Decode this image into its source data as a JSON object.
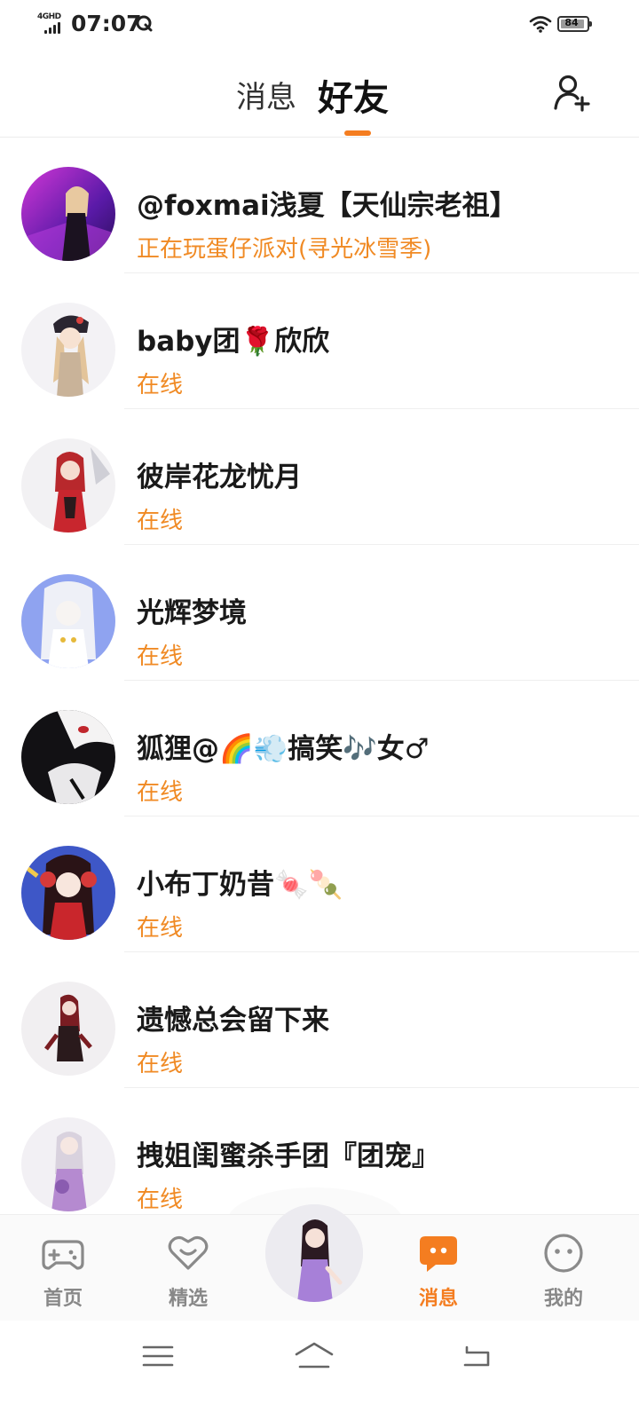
{
  "status_bar": {
    "network": "4GHD",
    "time": "07:07",
    "battery": "84"
  },
  "header": {
    "tab_messages": "消息",
    "tab_friends": "好友",
    "active_tab": "好友",
    "add_friend_icon": "add-user-icon"
  },
  "friends": [
    {
      "name": "@foxmai浅夏【天仙宗老祖】",
      "status": "正在玩蛋仔派对(寻光冰雪季)"
    },
    {
      "name": "baby团🌹欣欣",
      "status": "在线"
    },
    {
      "name": "彼岸花龙忧月",
      "status": "在线"
    },
    {
      "name": "光辉梦境",
      "status": "在线"
    },
    {
      "name": "狐狸@🌈💨搞笑🎶女♂",
      "status": "在线"
    },
    {
      "name": "小布丁奶昔🍬🍡",
      "status": "在线"
    },
    {
      "name": "遗憾总会留下来",
      "status": "在线"
    },
    {
      "name": "拽姐闺蜜杀手团『团宠』",
      "status": "在线"
    }
  ],
  "bottom_nav": {
    "home": "首页",
    "featured": "精选",
    "messages": "消息",
    "mine": "我的",
    "active": "消息"
  },
  "colors": {
    "accent": "#f47d20",
    "status_text": "#f08a24",
    "nav_inactive": "#888888"
  }
}
